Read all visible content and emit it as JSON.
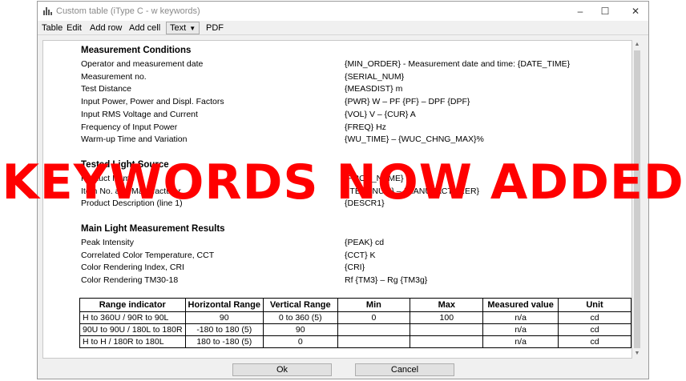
{
  "window": {
    "title": "Custom table (iType C - w keywords)",
    "controls": {
      "minimize": "–",
      "maximize": "☐",
      "close": "✕"
    }
  },
  "menubar": {
    "items": [
      "Table",
      "Edit",
      "Add row",
      "Add cell",
      "Text",
      "PDF"
    ]
  },
  "measurement_conditions": {
    "heading": "Measurement Conditions",
    "rows": [
      {
        "label": "Operator and measurement date",
        "value": "{MIN_ORDER}   -   Measurement date and time: {DATE_TIME}"
      },
      {
        "label": "Measurement no.",
        "value": "{SERIAL_NUM}"
      },
      {
        "label": "Test Distance",
        "value": "{MEASDIST} m"
      },
      {
        "label": "Input Power, Power and Displ. Factors",
        "value": "{PWR} W   –   PF {PF}   –   DPF {DPF}"
      },
      {
        "label": "Input RMS Voltage and Current",
        "value": "{VOL} V   –   {CUR} A"
      },
      {
        "label": "Frequency of Input Power",
        "value": "{FREQ} Hz"
      },
      {
        "label": "Warm-up Time and Variation",
        "value": "{WU_TIME}   –   {WUC_CHNG_MAX}%"
      }
    ]
  },
  "tested_light_source": {
    "heading": "Tested Light Source",
    "rows": [
      {
        "label": "Product Name",
        "value": "{PROD_NAME}"
      },
      {
        "label": "Item No. and Manufacturer",
        "value": "{ITEM_NUM}   –   {MANUFACTURER}"
      },
      {
        "label": "Product Description (line 1)",
        "value": "{DESCR1}"
      }
    ]
  },
  "main_results": {
    "heading": "Main Light Measurement Results",
    "rows": [
      {
        "label": "Peak Intensity",
        "value": "{PEAK} cd"
      },
      {
        "label": "Correlated Color Temperature, CCT",
        "value": "{CCT} K"
      },
      {
        "label": "Color Rendering Index, CRI",
        "value": "{CRI}"
      },
      {
        "label": "Color Rendering TM30-18",
        "value": "Rf {TM3}   –   Rg {TM3g}"
      }
    ]
  },
  "results_table": {
    "headers": [
      "Range indicator",
      "Horizontal Range",
      "Vertical Range",
      "Min",
      "Max",
      "Measured value",
      "Unit"
    ],
    "rows": [
      [
        "H to 360U / 90R to 90L",
        "90",
        "0 to 360 (5)",
        "0",
        "100",
        "n/a",
        "cd"
      ],
      [
        "90U to 90U / 180L to 180R",
        "-180 to 180 (5)",
        "90",
        "",
        "",
        "n/a",
        "cd"
      ],
      [
        "H to H / 180R to 180L",
        "180 to -180 (5)",
        "0",
        "",
        "",
        "n/a",
        "cd"
      ]
    ]
  },
  "buttons": {
    "ok": "Ok",
    "cancel": "Cancel"
  },
  "overlay_text": "KEYWORDS NOW ADDED"
}
